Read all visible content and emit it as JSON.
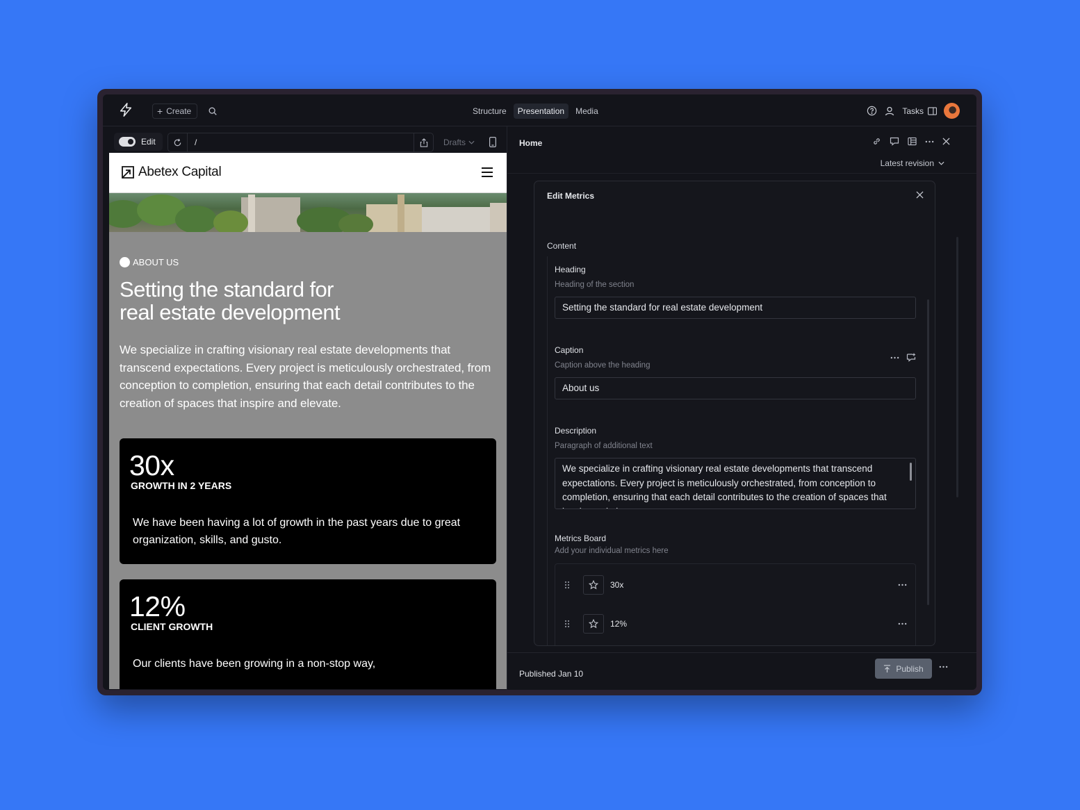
{
  "topbar": {
    "create_label": "Create",
    "nav": [
      {
        "label": "Structure",
        "active": false
      },
      {
        "label": "Presentation",
        "active": true
      },
      {
        "label": "Media",
        "active": false
      }
    ],
    "tasks_label": "Tasks"
  },
  "preview_toolbar": {
    "edit_label": "Edit",
    "path": "/",
    "drafts_label": "Drafts"
  },
  "site": {
    "brand": "Abetex Capital",
    "caption": "ABOUT US",
    "heading": "Setting the standard for real estate development",
    "description": "We specialize in crafting visionary real estate developments that transcend expectations. Every project is meticulously orchestrated, from conception to completion, ensuring that each detail contributes to the creation of spaces that inspire and elevate.",
    "metrics": [
      {
        "value": "30x",
        "label": "GROWTH IN 2 YEARS",
        "text": "We have been having a lot of growth in the past years due to great organization, skills, and gusto."
      },
      {
        "value": "12%",
        "label": "CLIENT GROWTH",
        "text": "Our clients have been growing in a non-stop way,"
      }
    ]
  },
  "document": {
    "title": "Home",
    "revision_label": "Latest revision"
  },
  "editor": {
    "title": "Edit Metrics",
    "section": "Content",
    "fields": {
      "heading": {
        "label": "Heading",
        "hint": "Heading of the section",
        "value": "Setting the standard for real estate development"
      },
      "caption": {
        "label": "Caption",
        "hint": "Caption above the heading",
        "value": "About us"
      },
      "description": {
        "label": "Description",
        "hint": "Paragraph of additional text",
        "value": "We specialize in crafting visionary real estate developments that transcend expectations. Every project is meticulously orchestrated, from conception to completion, ensuring that each detail contributes to the creation of spaces that inspire and elevate."
      },
      "metrics": {
        "label": "Metrics Board",
        "hint": "Add your individual metrics here",
        "items": [
          "30x",
          "12%"
        ]
      }
    }
  },
  "footer": {
    "status": "Published Jan 10",
    "publish_label": "Publish"
  },
  "colors": {
    "background": "#3677f6",
    "app_bg": "#13141a",
    "preview_bg": "#8c8c8c",
    "card_bg": "#000000",
    "publish_bg": "#59606d"
  }
}
